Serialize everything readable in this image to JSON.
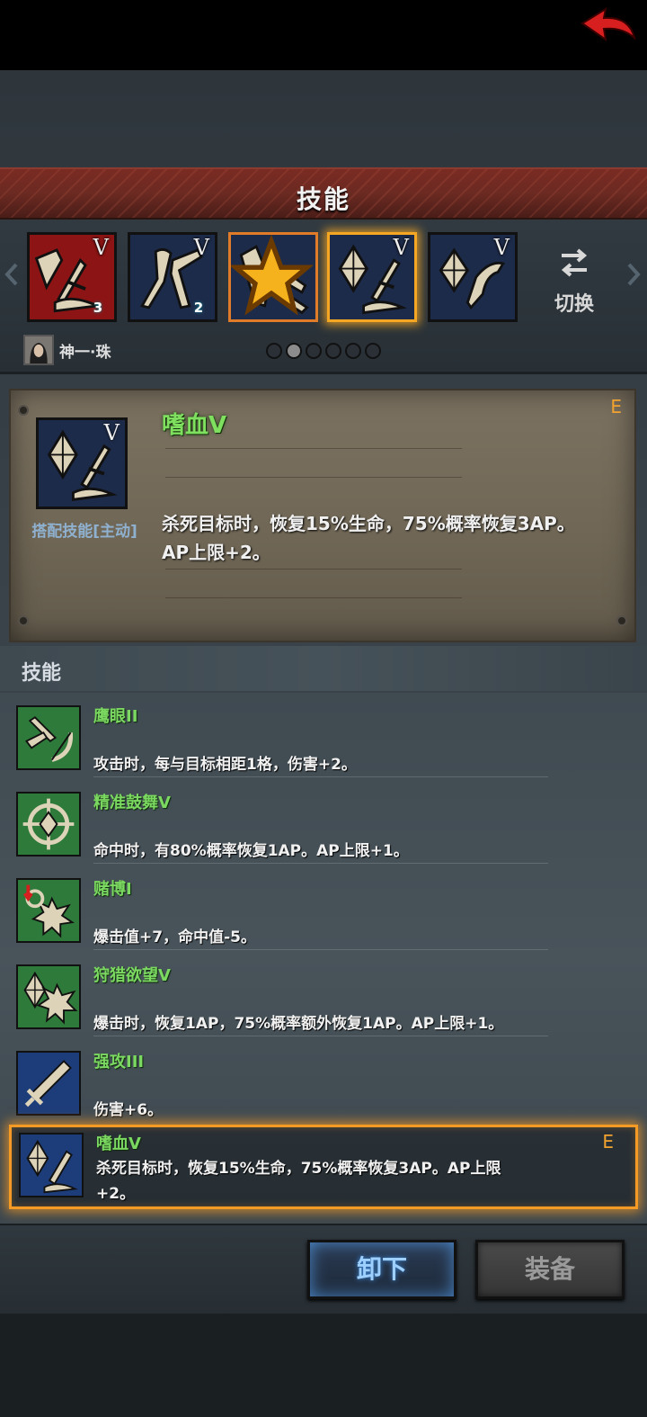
{
  "header": {
    "title": "技能"
  },
  "strip": {
    "slots": [
      {
        "level": "V",
        "gem": "3"
      },
      {
        "level": "V",
        "gem": "2"
      },
      {
        "level": ""
      },
      {
        "level": "V"
      },
      {
        "level": "V"
      }
    ],
    "switch_label": "切换",
    "character_name": "神一·珠"
  },
  "detail": {
    "name": "嗜血V",
    "grade": "E",
    "level": "V",
    "type": "搭配技能[主动]",
    "description": "杀死目标时，恢复15%生命，75%概率恢复3AP。AP上限+2。"
  },
  "list": {
    "title": "技能",
    "items": [
      {
        "name": "鹰眼II",
        "desc": "攻击时，每与目标相距1格，伤害+2。"
      },
      {
        "name": "精准鼓舞V",
        "desc": "命中时，有80%概率恢复1AP。AP上限+1。"
      },
      {
        "name": "赌博I",
        "desc": "爆击值+7，命中值-5。"
      },
      {
        "name": "狩猎欲望V",
        "desc": "爆击时，恢复1AP，75%概率额外恢复1AP。AP上限+1。"
      },
      {
        "name": "强攻III",
        "desc": "伤害+6。"
      },
      {
        "name": "嗜血V",
        "desc": "杀死目标时，恢复15%生命，75%概率恢复3AP。AP上限+2。",
        "grade": "E"
      }
    ]
  },
  "buttons": {
    "unload": "卸下",
    "equip": "装备"
  }
}
